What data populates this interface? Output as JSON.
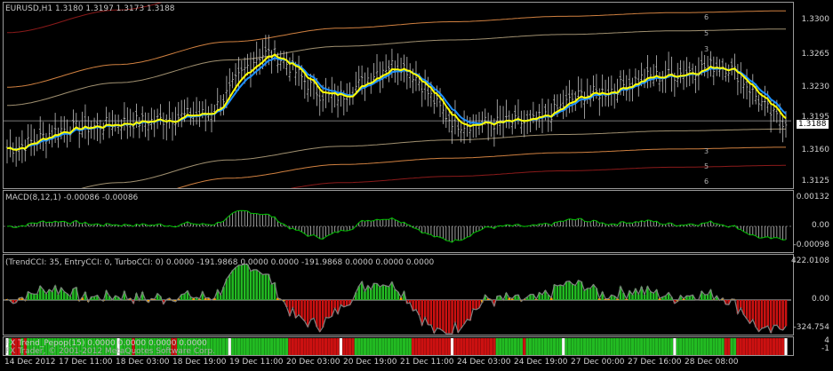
{
  "main": {
    "header": "EURUSD,H1  1.3180 1.3197 1.3173 1.3188",
    "current_price": "1.3188",
    "y_ticks": [
      "1.3300",
      "1.3265",
      "1.3230",
      "1.3195",
      "1.3160",
      "1.3125"
    ],
    "envelope_labels_top": [
      "6",
      "5",
      "3"
    ],
    "envelope_labels_bottom": [
      "3",
      "5",
      "6"
    ]
  },
  "macd": {
    "header": "MACD(8,12,1) -0.00086 -0.00086",
    "y_ticks": [
      "0.00132",
      "0.00",
      "-0.00098"
    ]
  },
  "cci": {
    "header": "(TrendCCI: 35, EntryCCI: 0, TurboCCI: 0)  0.0000 -191.9868 0.0000 0.0000 -191.9868 0.0000 0.0000 0.0000",
    "y_ticks": [
      "422.0108",
      "0.00",
      "-324.754"
    ]
  },
  "footer_text": "FX Trend_Pepop(15) 0.0000 0.0000 0.0000 0.0000",
  "watermark": "FX Trader, © 2001-2012 MetaQuotes Software Corp.",
  "bottom_indicator": {
    "y_ticks": [
      "4",
      "-1"
    ]
  },
  "x_labels": [
    "14 Dec 2012",
    "17 Dec 11:00",
    "18 Dec 03:00",
    "18 Dec 19:00",
    "19 Dec 11:00",
    "20 Dec 03:00",
    "20 Dec 19:00",
    "21 Dec 11:00",
    "24 Dec 03:00",
    "24 Dec 19:00",
    "27 Dec 00:00",
    "27 Dec 16:00",
    "28 Dec 08:00"
  ],
  "colors": {
    "background": "#000000",
    "ema_fast": "#ffff00",
    "ema_slow": "#1e90ff",
    "candle": "#c0c0c0",
    "macd": "#00c000",
    "cci_up": "#22bb22",
    "cci_down": "#cc1111",
    "cci_neutral": "#ffa500",
    "band1": "#8b1a1a",
    "band2": "#d08040",
    "band3": "#a09070"
  },
  "chart_data": {
    "type": "line",
    "symbol": "EURUSD",
    "timeframe": "H1",
    "ylim": [
      1.3112,
      1.3318
    ],
    "x": [
      "14 Dec 2012",
      "17 Dec 11:00",
      "18 Dec 03:00",
      "18 Dec 19:00",
      "19 Dec 11:00",
      "20 Dec 03:00",
      "20 Dec 19:00",
      "21 Dec 11:00",
      "24 Dec 03:00",
      "24 Dec 19:00",
      "27 Dec 00:00",
      "27 Dec 16:00",
      "28 Dec 08:00"
    ],
    "series": [
      {
        "name": "",
        "values": [
          1.3158,
          1.318,
          1.3187,
          1.3195,
          1.3262,
          1.3214,
          1.325,
          1.3185,
          1.3186,
          1.3218,
          1.3237,
          1.3249,
          1.3188
        ]
      }
    ]
  }
}
